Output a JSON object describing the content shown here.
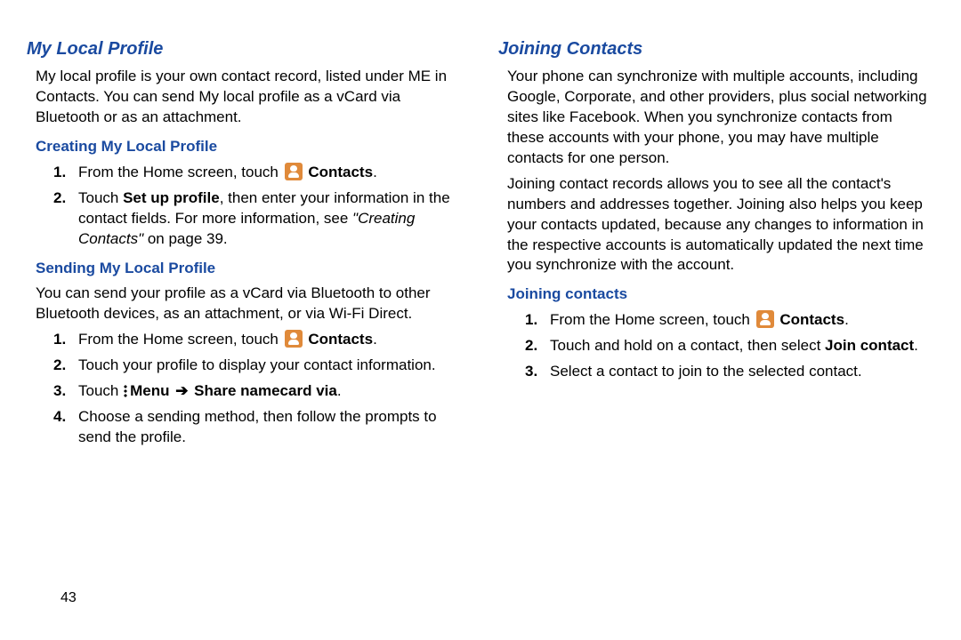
{
  "page_number": "43",
  "left": {
    "h2": "My Local Profile",
    "intro": "My local profile is your own contact record, listed under ME in Contacts. You can send My local profile as a vCard via Bluetooth or as an attachment.",
    "creating": {
      "h3": "Creating My Local Profile",
      "step1_a": "From the Home screen, touch ",
      "step1_b": " Contacts",
      "step1_c": ".",
      "step2_a": "Touch ",
      "step2_b": "Set up profile",
      "step2_c": ", then enter your information in the contact fields. For more information, see ",
      "step2_d": "\"Creating Contacts\"",
      "step2_e": " on page 39."
    },
    "sending": {
      "h3": "Sending My Local Profile",
      "intro": "You can send your profile as a vCard via Bluetooth to other Bluetooth devices, as an attachment, or via Wi-Fi Direct.",
      "step1_a": "From the Home screen, touch ",
      "step1_b": " Contacts",
      "step1_c": ".",
      "step2": "Touch your profile to display your contact information.",
      "step3_a": "Touch ",
      "step3_b": "Menu ",
      "step3_arrow": "➔",
      "step3_c": " Share namecard via",
      "step3_d": ".",
      "step4": "Choose a sending method, then follow the prompts to send the profile."
    }
  },
  "right": {
    "h2": "Joining Contacts",
    "p1": "Your phone can synchronize with multiple accounts, including Google, Corporate, and other providers, plus social networking sites like Facebook. When you synchronize contacts from these accounts with your phone, you may have multiple contacts for one person.",
    "p2": "Joining contact records allows you to see all the contact's numbers and addresses together. Joining also helps you keep your contacts updated, because any changes to information in the respective accounts is automatically updated the next time you synchronize with the account.",
    "joining": {
      "h3": "Joining contacts",
      "step1_a": "From the Home screen, touch ",
      "step1_b": " Contacts",
      "step1_c": ".",
      "step2_a": "Touch and hold on a contact, then select ",
      "step2_b": "Join contact",
      "step2_c": ".",
      "step3": "Select a contact to join to the selected contact."
    }
  }
}
